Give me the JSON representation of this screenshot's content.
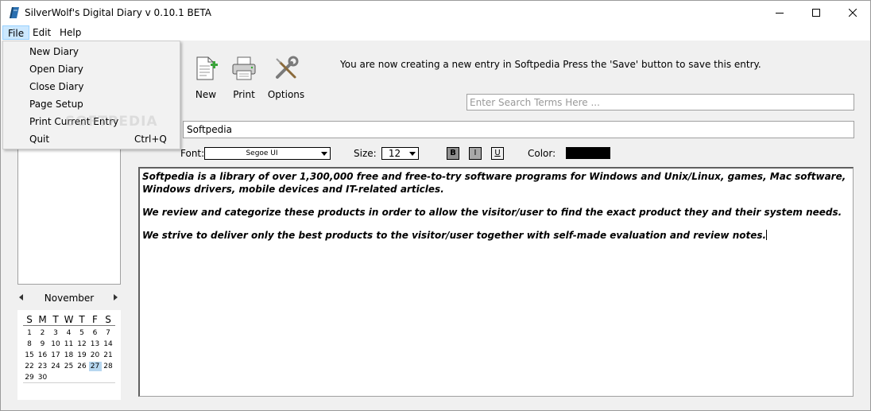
{
  "window": {
    "title": "SilverWolf's Digital Diary v 0.10.1 BETA",
    "icons": {
      "app": "diary-book-icon",
      "minimize": "minimize-icon",
      "maximize": "maximize-icon",
      "close": "close-icon"
    }
  },
  "menubar": {
    "items": [
      "File",
      "Edit",
      "Help"
    ],
    "active": "File"
  },
  "file_menu": {
    "items": [
      {
        "label": "New Diary",
        "shortcut": ""
      },
      {
        "label": "Open Diary",
        "shortcut": ""
      },
      {
        "label": "Close Diary",
        "shortcut": ""
      },
      {
        "label": "Page Setup",
        "shortcut": ""
      },
      {
        "label": "Print Current Entry",
        "shortcut": ""
      },
      {
        "label": "Quit",
        "shortcut": "Ctrl+Q"
      }
    ]
  },
  "watermark": "SOFTPEDIA",
  "toolbar": {
    "new_label": "New",
    "print_label": "Print",
    "options_label": "Options",
    "icons": {
      "new": "new-document-icon",
      "print": "printer-icon",
      "options": "wrench-screwdriver-icon"
    }
  },
  "notice": "You are now creating a new entry in Softpedia Press the 'Save' button to save this entry.",
  "search": {
    "placeholder": "Enter Search Terms Here ...",
    "value": ""
  },
  "entry": {
    "title": "Softpedia"
  },
  "format": {
    "font_label": "Font:",
    "font_value": "Segoe UI",
    "size_label": "Size:",
    "size_value": "12",
    "bold": "B",
    "italic": "I",
    "underline": "U",
    "color_label": "Color:",
    "color_value": "#000000"
  },
  "editor": {
    "paragraphs": [
      "Softpedia is a library of over 1,300,000 free and free-to-try software programs for Windows and Unix/Linux, games, Mac software, Windows drivers, mobile devices and IT-related articles.",
      "We review and categorize these products in order to allow the visitor/user to find the exact product they and their system needs.",
      "We strive to deliver only the best products to the visitor/user together with self-made evaluation and review notes."
    ]
  },
  "calendar": {
    "month": "November",
    "weekdays": [
      "S",
      "M",
      "T",
      "W",
      "T",
      "F",
      "S"
    ],
    "weeks": [
      [
        "1",
        "2",
        "3",
        "4",
        "5",
        "6",
        "7"
      ],
      [
        "8",
        "9",
        "10",
        "11",
        "12",
        "13",
        "14"
      ],
      [
        "15",
        "16",
        "17",
        "18",
        "19",
        "20",
        "21"
      ],
      [
        "22",
        "23",
        "24",
        "25",
        "26",
        "27",
        "28"
      ],
      [
        "29",
        "30",
        "",
        "",
        "",
        "",
        ""
      ]
    ],
    "selected": "27"
  }
}
